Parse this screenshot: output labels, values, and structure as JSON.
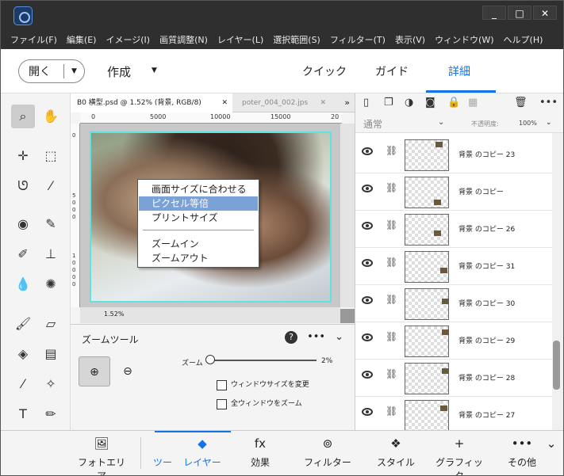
{
  "window": {
    "min": "_",
    "max": "□",
    "close": "✕"
  },
  "menu": [
    "ファイル(F)",
    "編集(E)",
    "イメージ(I)",
    "画質調整(N)",
    "レイヤー(L)",
    "選択範囲(S)",
    "フィルター(T)",
    "表示(V)",
    "ウィンドウ(W)",
    "ヘルプ(H)"
  ],
  "modebar": {
    "open_label": "開く",
    "create_label": "作成",
    "tabs": [
      "クイック",
      "ガイド",
      "詳細"
    ]
  },
  "doc_tabs": [
    {
      "label": "B0 横型.psd @ 1.52% (背景, RGB/8)",
      "close": "✕"
    },
    {
      "label": "poter_004_002.jps",
      "close": "✕"
    }
  ],
  "more_tabs": "»",
  "ruler_h": [
    "0",
    "5000",
    "10000",
    "15000",
    "20"
  ],
  "ruler_v": [
    [
      "0"
    ],
    [
      "5",
      "0",
      "0",
      "0"
    ],
    [
      "1",
      "0",
      "0",
      "0",
      "0"
    ]
  ],
  "zoom_level_status": "1.52%",
  "context_menu": {
    "items": [
      "画面サイズに合わせる",
      "ピクセル等倍",
      "プリントサイズ",
      "ズームイン",
      "ズームアウト"
    ],
    "highlighted_index": 1
  },
  "tool_options": {
    "title": "ズームツール",
    "help": "?",
    "more": "•••",
    "collapse": "⌄",
    "zoom_label": "ズーム",
    "zoom_value": "2%",
    "zoom_fraction": 0.0,
    "check_resize": "ウィンドウサイズを変更",
    "check_all": "全ウィンドウをズーム"
  },
  "layers_panel": {
    "blend_mode": "通常",
    "opacity_label": "不透明度:",
    "opacity_value": "100%",
    "layers": [
      "背景 のコピー 23",
      "背景 のコピー",
      "背景 のコピー 26",
      "背景 のコピー 31",
      "背景 のコピー 30",
      "背景 のコピー 29",
      "背景 のコピー 28",
      "背景 のコピー 27"
    ]
  },
  "bottom_bar": [
    "フォトエリア",
    "ツー",
    "レイヤー",
    "効果",
    "フィルター",
    "スタイル",
    "グラフィック",
    "その他"
  ],
  "colors": {
    "accent": "#1473e6",
    "highlight": "#7aa2d6",
    "selection_border": "#5ee3e3"
  }
}
